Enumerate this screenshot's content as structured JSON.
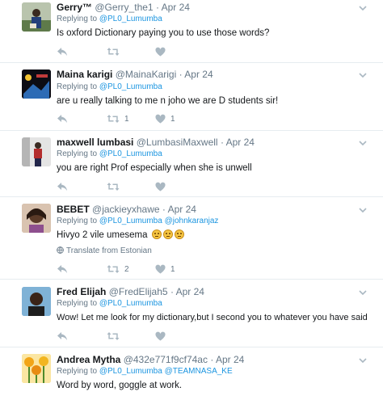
{
  "colors": {
    "link": "#1b95e0",
    "muted": "#657786",
    "icon": "#aab8c2",
    "divider": "#e6ecf0"
  },
  "tweets": [
    {
      "name": "Gerry™",
      "handle": "@Gerry_the1",
      "time": "Apr 24",
      "replying_prefix": "Replying to",
      "replying_to": "@PL0_Lumumba",
      "replying_extra": "",
      "text": "Is oxford Dictionary paying you to use those words?",
      "translate": "",
      "reply_count": "",
      "retweet_count": "",
      "like_count": ""
    },
    {
      "name": "Maina karigi",
      "handle": "@MainaKarigi",
      "time": "Apr 24",
      "replying_prefix": "Replying to",
      "replying_to": "@PL0_Lumumba",
      "replying_extra": "",
      "text": "are u really talking to me n joho we are D students sir!",
      "translate": "",
      "reply_count": "",
      "retweet_count": "1",
      "like_count": "1"
    },
    {
      "name": "maxwell lumbasi",
      "handle": "@LumbasiMaxwell",
      "time": "Apr 24",
      "replying_prefix": "Replying to",
      "replying_to": "@PL0_Lumumba",
      "replying_extra": "",
      "text": "you are right Prof especially when she is unwell",
      "translate": "",
      "reply_count": "",
      "retweet_count": "",
      "like_count": ""
    },
    {
      "name": "BEBET",
      "handle": "@jackieyxhawe",
      "time": "Apr 24",
      "replying_prefix": "Replying to",
      "replying_to": "@PL0_Lumumba",
      "replying_extra": "@johnkaranjaz",
      "text": "Hivyo 2 vile umesema",
      "translate": "Translate from Estonian",
      "reply_count": "",
      "retweet_count": "2",
      "like_count": "1"
    },
    {
      "name": "Fred Elijah",
      "handle": "@FredElijah5",
      "time": "Apr 24",
      "replying_prefix": "Replying to",
      "replying_to": "@PL0_Lumumba",
      "replying_extra": "",
      "text": "Wow! Let me look for my dictionary,but I second you to whatever you have said",
      "translate": "",
      "reply_count": "",
      "retweet_count": "",
      "like_count": ""
    },
    {
      "name": "Andrea Mytha",
      "handle": "@432e771f9cf74ac",
      "time": "Apr 24",
      "replying_prefix": "Replying to",
      "replying_to": "@PL0_Lumumba",
      "replying_extra": "@TEAMNASA_KE",
      "text": "Word by word, goggle at work.",
      "translate": "",
      "reply_count": "",
      "retweet_count": "",
      "like_count": ""
    }
  ]
}
